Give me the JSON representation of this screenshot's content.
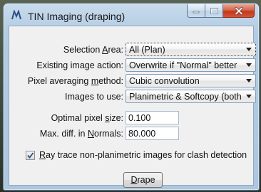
{
  "window": {
    "title": "TIN Imaging (draping)"
  },
  "form": {
    "selection_area": {
      "label_pre": "Selection ",
      "label_key": "A",
      "label_post": "rea:",
      "value": "All (Plan)"
    },
    "existing_image_action": {
      "label": "Existing image action:",
      "value": "Overwrite if \"Normal\" better"
    },
    "pixel_averaging_method": {
      "label_pre": "Pixel averaging ",
      "label_key": "m",
      "label_post": "ethod:",
      "value": "Cubic convolution"
    },
    "images_to_use": {
      "label": "Images to use:",
      "value": "Planimetric & Softcopy (both"
    },
    "optimal_pixel_size": {
      "label_pre": "Optimal pixel ",
      "label_key": "s",
      "label_post": "ize:",
      "value": "0.100"
    },
    "max_diff_normals": {
      "label_pre": "Max. diff. in ",
      "label_key": "N",
      "label_post": "ormals:",
      "value": "80.000"
    },
    "ray_trace": {
      "label_key": "R",
      "label_post": "ay trace non-planimetric images for clash detection",
      "checked": true
    },
    "drape_button": {
      "label_key": "D",
      "label_post": "rape"
    }
  },
  "colors": {
    "accent": "#3c6fa8",
    "close": "#c4381a"
  }
}
